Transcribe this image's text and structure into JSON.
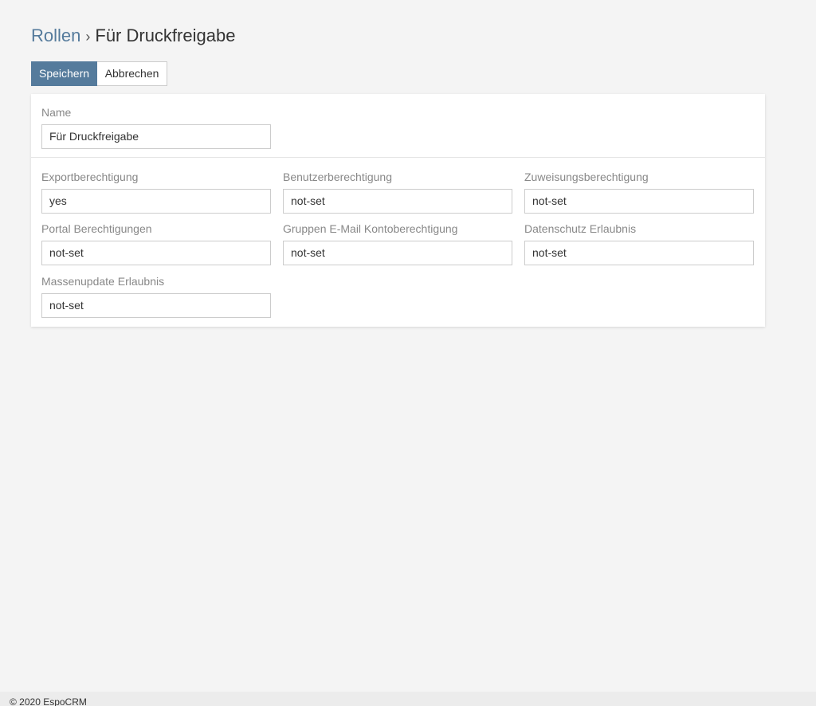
{
  "header": {
    "breadcrumb_link": "Rollen",
    "separator": "›",
    "current": "Für Druckfreigabe"
  },
  "toolbar": {
    "save_label": "Speichern",
    "cancel_label": "Abbrechen"
  },
  "fields": {
    "name": {
      "label": "Name",
      "value": "Für Druckfreigabe"
    },
    "export": {
      "label": "Exportberechtigung",
      "value": "yes"
    },
    "user": {
      "label": "Benutzerberechtigung",
      "value": "not-set"
    },
    "assignment": {
      "label": "Zuweisungsberechtigung",
      "value": "not-set"
    },
    "portal": {
      "label": "Portal Berechtigungen",
      "value": "not-set"
    },
    "group_email": {
      "label": "Gruppen E-Mail Kontoberechtigung",
      "value": "not-set"
    },
    "privacy": {
      "label": "Datenschutz Erlaubnis",
      "value": "not-set"
    },
    "mass_update": {
      "label": "Massenupdate Erlaubnis",
      "value": "not-set"
    }
  },
  "footer": {
    "copyright": "© 2020 EspoCRM"
  },
  "colors": {
    "accent": "#557b9c",
    "background": "#f4f4f4",
    "panel": "#ffffff"
  }
}
